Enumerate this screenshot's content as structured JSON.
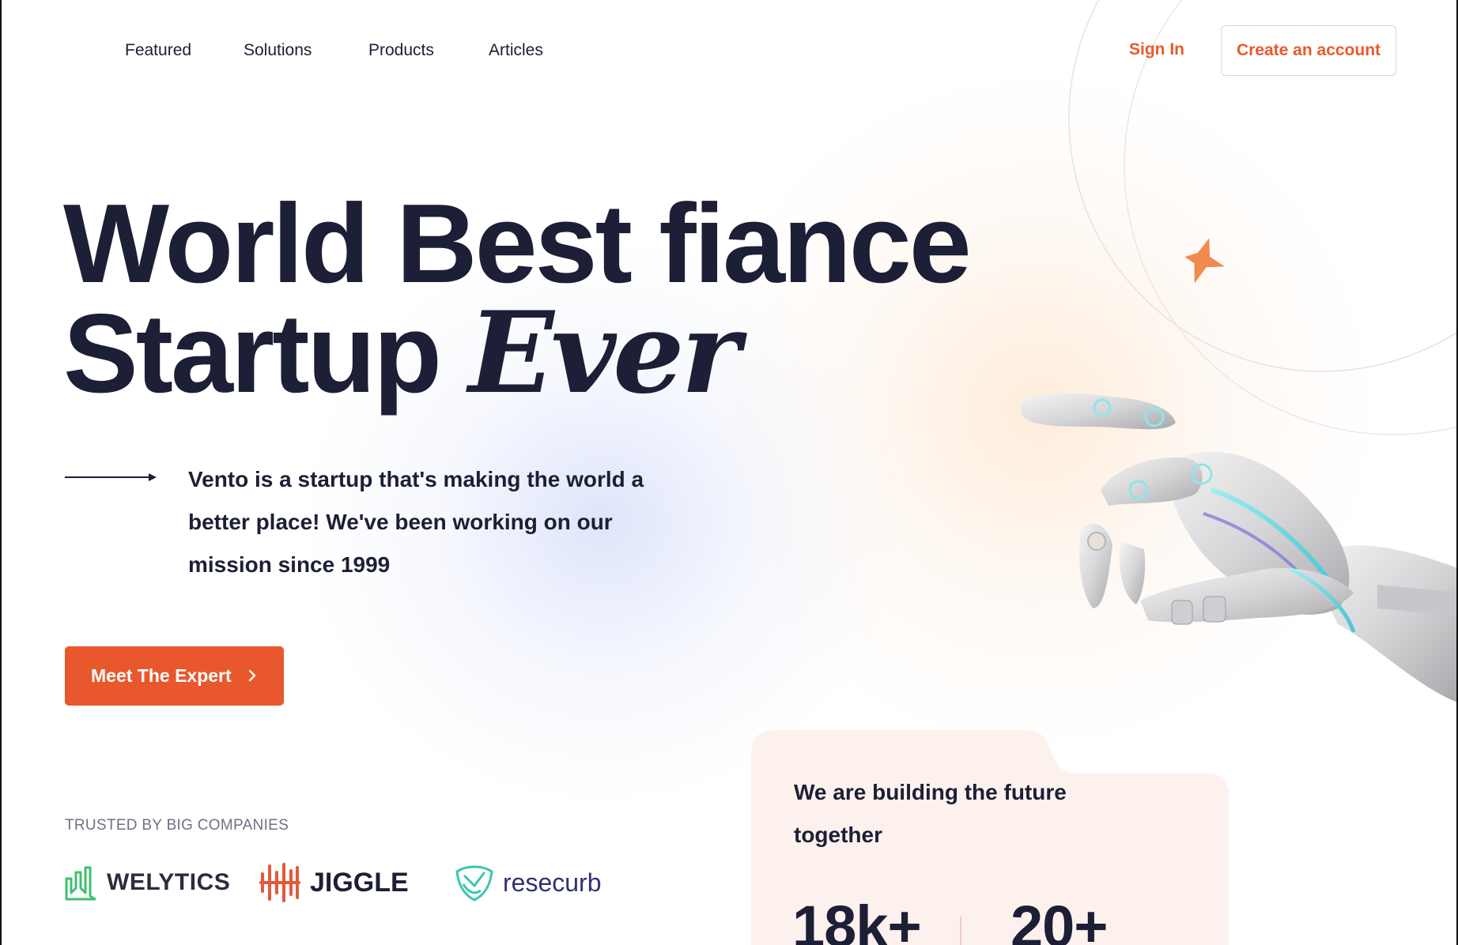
{
  "nav": {
    "links": [
      "Featured",
      "Solutions",
      "Products",
      "Articles"
    ],
    "sign_in": "Sign In",
    "create_account": "Create an account"
  },
  "hero": {
    "line1": "World Best fiance",
    "line2_main": "Startup",
    "line2_italic": "Ever",
    "description": "Vento is a startup that's making the world a better place! We've been working on our mission since 1999",
    "cta": "Meet The Expert"
  },
  "trusted": {
    "label": "TRUSTED BY BIG COMPANIES",
    "logos": [
      {
        "name": "WELYTICS",
        "icon": "bar-chart-icon",
        "color": "#3fbf6f"
      },
      {
        "name": "JIGGLE",
        "icon": "soundwave-icon",
        "color": "#e35a3a"
      },
      {
        "name": "resecurb",
        "icon": "shield-icon",
        "color": "#3cc6b0"
      }
    ]
  },
  "card": {
    "title": "We are building the future together",
    "stats": [
      "18k+",
      "20+"
    ]
  },
  "colors": {
    "accent": "#e8582c",
    "text": "#1c1f35",
    "card_bg": "#fdf1ee"
  }
}
